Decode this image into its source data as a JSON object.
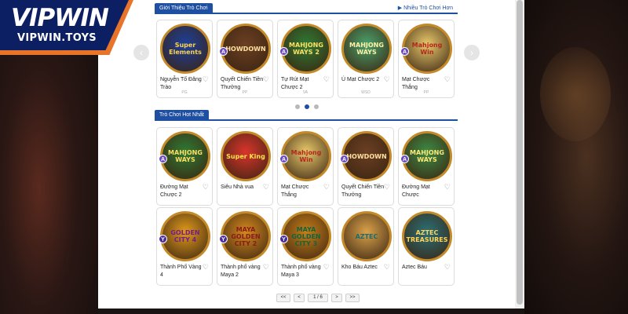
{
  "brand": {
    "title": "VIPWIN",
    "domain": "VIPWIN.TOYS"
  },
  "intro": {
    "heading": "Giới Thiệu Trò Chơi",
    "more_link": "Nhiều Trò Chơi Hơn",
    "cards": [
      {
        "name": "Nguyễn Tố Đăng Trào",
        "thumb": "Super Elements",
        "sub": "PG",
        "color": "#1d3f9a",
        "text": "#ffd34a",
        "badge": ""
      },
      {
        "name": "Quyết Chiến Tiền Thưởng",
        "thumb": "HOWDOWN",
        "sub": "PP",
        "color": "#6b3f22",
        "text": "#ffe0a0",
        "badge": "A"
      },
      {
        "name": "Tự Rút Mạt Chược 2",
        "thumb": "MAHJONG WAYS 2",
        "sub": "VA",
        "color": "#2f7a34",
        "text": "#ffdf60",
        "badge": "A"
      },
      {
        "name": "Ú Mạt Chược 2",
        "thumb": "MAHJONG WAYS",
        "sub": "WSD",
        "color": "#4aa06a",
        "text": "#fff2a8",
        "badge": ""
      },
      {
        "name": "Mạt Chược Thắng",
        "thumb": "Mahjong Win",
        "sub": "PP",
        "color": "#e8c86a",
        "text": "#b3261e",
        "badge": "A"
      }
    ],
    "hot": {
      "heading": "Trò Chơi Hot Nhất"
    }
  },
  "hot_cards": [
    {
      "name": "Đường Mạt Chược 2",
      "thumb": "MAHJONG WAYS",
      "color": "#2f7a34",
      "text": "#ffdf60",
      "badge": "A"
    },
    {
      "name": "Siêu Nhà vua",
      "thumb": "Super King",
      "color": "#d9342b",
      "text": "#ffe14a",
      "badge": ""
    },
    {
      "name": "Mạt Chược Thắng",
      "thumb": "Mahjong Win",
      "color": "#e8c86a",
      "text": "#b3261e",
      "badge": "A"
    },
    {
      "name": "Quyết Chiến Tiền Thưởng",
      "thumb": "HOWDOWN",
      "color": "#6b3f22",
      "text": "#ffe0a0",
      "badge": "A"
    },
    {
      "name": "Đường Mạt Chược",
      "thumb": "MAHJONG WAYS",
      "color": "#3d8a44",
      "text": "#ffe878",
      "badge": "A"
    },
    {
      "name": "Thành Phố Vàng 4",
      "thumb": "GOLDEN CITY 4",
      "color": "#e09a1a",
      "text": "#7a1a8a",
      "badge": "Y"
    },
    {
      "name": "Thành phố vàng Maya 2",
      "thumb": "MAYA GOLDEN CITY 2",
      "color": "#d48a1c",
      "text": "#8b1a1a",
      "badge": "Y"
    },
    {
      "name": "Thành phố vàng Maya 3",
      "thumb": "MAYA GOLDEN CITY 3",
      "color": "#c77e18",
      "text": "#16633a",
      "badge": "Y"
    },
    {
      "name": "Kho Báu Aztec",
      "thumb": "AZTEC",
      "color": "#d9a24a",
      "text": "#1f6b6b",
      "badge": ""
    },
    {
      "name": "Aztec Báu",
      "thumb": "AZTEC TREASURES",
      "color": "#2a6f76",
      "text": "#ffd45a",
      "badge": ""
    }
  ],
  "pager": {
    "first": "<<",
    "prev": "<",
    "current": "1 / 6",
    "next": ">",
    "last": ">>"
  },
  "colors": {
    "accent": "#1f4fa0",
    "logo_orange": "#e8742a",
    "logo_navy": "#0c1f63"
  }
}
